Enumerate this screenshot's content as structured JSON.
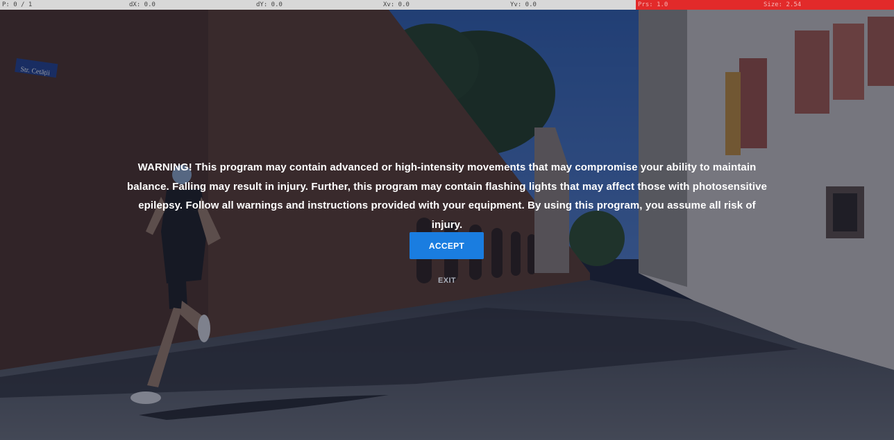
{
  "debug_bar": {
    "p": "P: 0 / 1",
    "dx": "dX: 0.0",
    "dy": "dY: 0.0",
    "xv": "Xv: 0.0",
    "yv": "Yv: 0.0",
    "prs": "Prs: 1.0",
    "size": "Size: 2.54"
  },
  "scene": {
    "street_sign": "Str. Cetății"
  },
  "dialog": {
    "warning": "WARNING! This program may contain advanced or high-intensity movements that may compromise your ability to maintain balance. Falling may result in injury. Further, this program may contain flashing lights that may affect those with photosensitive epilepsy. Follow all warnings and instructions provided with your equipment. By using this program, you assume all risk of injury.",
    "accept_label": "ACCEPT",
    "exit_label": "EXIT"
  },
  "colors": {
    "accent": "#1a7de0",
    "debug_alert": "#e22a2a"
  }
}
